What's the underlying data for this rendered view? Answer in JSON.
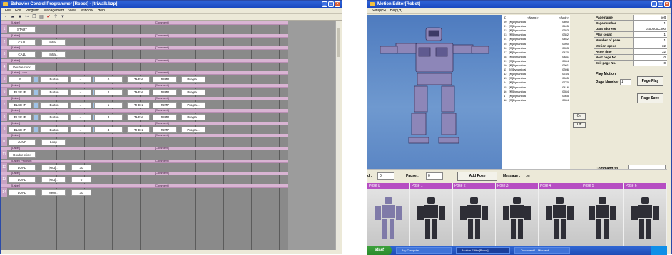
{
  "left_window": {
    "title": "Behavior Control Programmer [Robot] - [triwalk.bzp]",
    "menu": [
      "File",
      "Edit",
      "Program",
      "Management",
      "View",
      "Window",
      "Help"
    ],
    "rows": [
      {
        "num": "1",
        "label": "[Label]",
        "comment": "[Comment]",
        "cells": [
          "START"
        ]
      },
      {
        "num": "2",
        "label": "[Label]",
        "comment": "[Comment]",
        "cells": [
          "CALL",
          "Initia..."
        ]
      },
      {
        "num": "3",
        "label": "[Label]",
        "comment": "[Comment]",
        "cells": [
          "CALL",
          "Initia..."
        ]
      },
      {
        "num": "4",
        "label": "[Label]",
        "comment": "[Comment]",
        "cells": [
          "Double click!"
        ]
      },
      {
        "num": "5",
        "label": "[Label] Loop",
        "comment": "[Comment]",
        "cells": [
          "IF",
          "Button",
          "=",
          "0",
          "THEN",
          "JUMP",
          "Progra..."
        ]
      },
      {
        "num": "6",
        "label": "[Label]",
        "comment": "[Comment]",
        "cells": [
          "ELSE IF",
          "Button",
          "=",
          "2",
          "THEN",
          "JUMP",
          "Progra..."
        ]
      },
      {
        "num": "7",
        "label": "[Label]",
        "comment": "[Comment]",
        "cells": [
          "ELSE IF",
          "Button",
          "=",
          "1",
          "THEN",
          "JUMP",
          "Progra..."
        ]
      },
      {
        "num": "8",
        "label": "[Label]",
        "comment": "[Comment]",
        "cells": [
          "ELSE IF",
          "Button",
          "=",
          "3",
          "THEN",
          "JUMP",
          "Progra..."
        ]
      },
      {
        "num": "9",
        "label": "[Label]",
        "comment": "[Comment]",
        "cells": [
          "ELSE IF",
          "Button",
          "=",
          "4",
          "THEN",
          "JUMP",
          "Progra..."
        ]
      },
      {
        "num": "10",
        "label": "[Label]",
        "comment": "[Comment]",
        "cells": [
          "JUMP",
          "Loop"
        ]
      },
      {
        "num": "11",
        "label": "[Label]",
        "comment": "[Comment]",
        "cells": [
          "Double click!"
        ]
      },
      {
        "num": "12",
        "label": "[Label] Program",
        "comment": "[Comment]",
        "cells": [
          "LOAD",
          "[Mot]...",
          "30"
        ]
      },
      {
        "num": "13",
        "label": "[Label]",
        "comment": "[Comment]",
        "cells": [
          "LOAD",
          "[Mot]...",
          "0"
        ]
      },
      {
        "num": "14",
        "label": "[Label]",
        "comment": "[Comment]",
        "cells": [
          "LOAD",
          "Mem...",
          "30"
        ]
      }
    ]
  },
  "right_window": {
    "title": "Motion Editor[Robot]",
    "menu": [
      "Setup(S)",
      "Help(H)"
    ],
    "list_header": [
      "ID",
      "<Name>",
      "<Addr>"
    ],
    "list": [
      [
        "00",
        "[M]Dynamical",
        "0400"
      ],
      [
        "01",
        "[M]Dynamical",
        "0405"
      ],
      [
        "02",
        "[M]Dynamical",
        "0353"
      ],
      [
        "03",
        "[M]Dynamical",
        "0352"
      ],
      [
        "04",
        "[M]Dynamical",
        "0462"
      ],
      [
        "05",
        "[M]Dynamical",
        "0590"
      ],
      [
        "06",
        "[M]Dynamical",
        "0553"
      ],
      [
        "07",
        "[M]Dynamical",
        "0470"
      ],
      [
        "08",
        "[M]Dynamical",
        "0481"
      ],
      [
        "09",
        "[M]Dynamical",
        "0554"
      ],
      [
        "10",
        "[M]Dynamical",
        "0501"
      ],
      [
        "11",
        "[M]Dynamical",
        "0396"
      ],
      [
        "12",
        "[M]Dynamical",
        "0784"
      ],
      [
        "13",
        "[M]Dynamical",
        "0565"
      ],
      [
        "14",
        "[M]Dynamical",
        "0770"
      ],
      [
        "15",
        "[M]Dynamical",
        "0416"
      ],
      [
        "16",
        "[M]Dynamical",
        "0554"
      ],
      [
        "17",
        "[M]Dynamical",
        "0565"
      ],
      [
        "18",
        "[M]Dynamical",
        "0554"
      ]
    ],
    "on_label": "On",
    "off_label": "Off",
    "properties": [
      {
        "key": "Page name",
        "value": "kelt"
      },
      {
        "key": "Page number",
        "value": "1"
      },
      {
        "key": "Data address",
        "value": "0x00000C300"
      },
      {
        "key": "Play count",
        "value": "1"
      },
      {
        "key": "Number of pose",
        "value": "1"
      },
      {
        "key": "Motion speed",
        "value": "32"
      },
      {
        "key": "Accel time",
        "value": "32"
      },
      {
        "key": "Next page No.",
        "value": "0"
      },
      {
        "key": "Exit page No.",
        "value": "0"
      }
    ],
    "play_motion": "Play Motion",
    "page_number_label": "Page Number",
    "page_number_value": "1",
    "play_button": "Page Play",
    "save_button": "Page Save",
    "command_label": "Command >>",
    "controls": {
      "speed_label": "d :",
      "speed_value": "0",
      "pause_label": "Pause :",
      "pause_value": "0",
      "add_pose": "Add Pose",
      "message_label": "Message :",
      "message_value": "on"
    },
    "poses": [
      "Pose 0",
      "Pose 1",
      "Pose 2",
      "Pose 3",
      "Pose 4",
      "Pose 5",
      "Pose 6"
    ],
    "taskbar": {
      "start": "start",
      "tasks": [
        "My Computer",
        "Motion Editor[Robot]",
        "Document1 - Microsof..."
      ]
    }
  }
}
